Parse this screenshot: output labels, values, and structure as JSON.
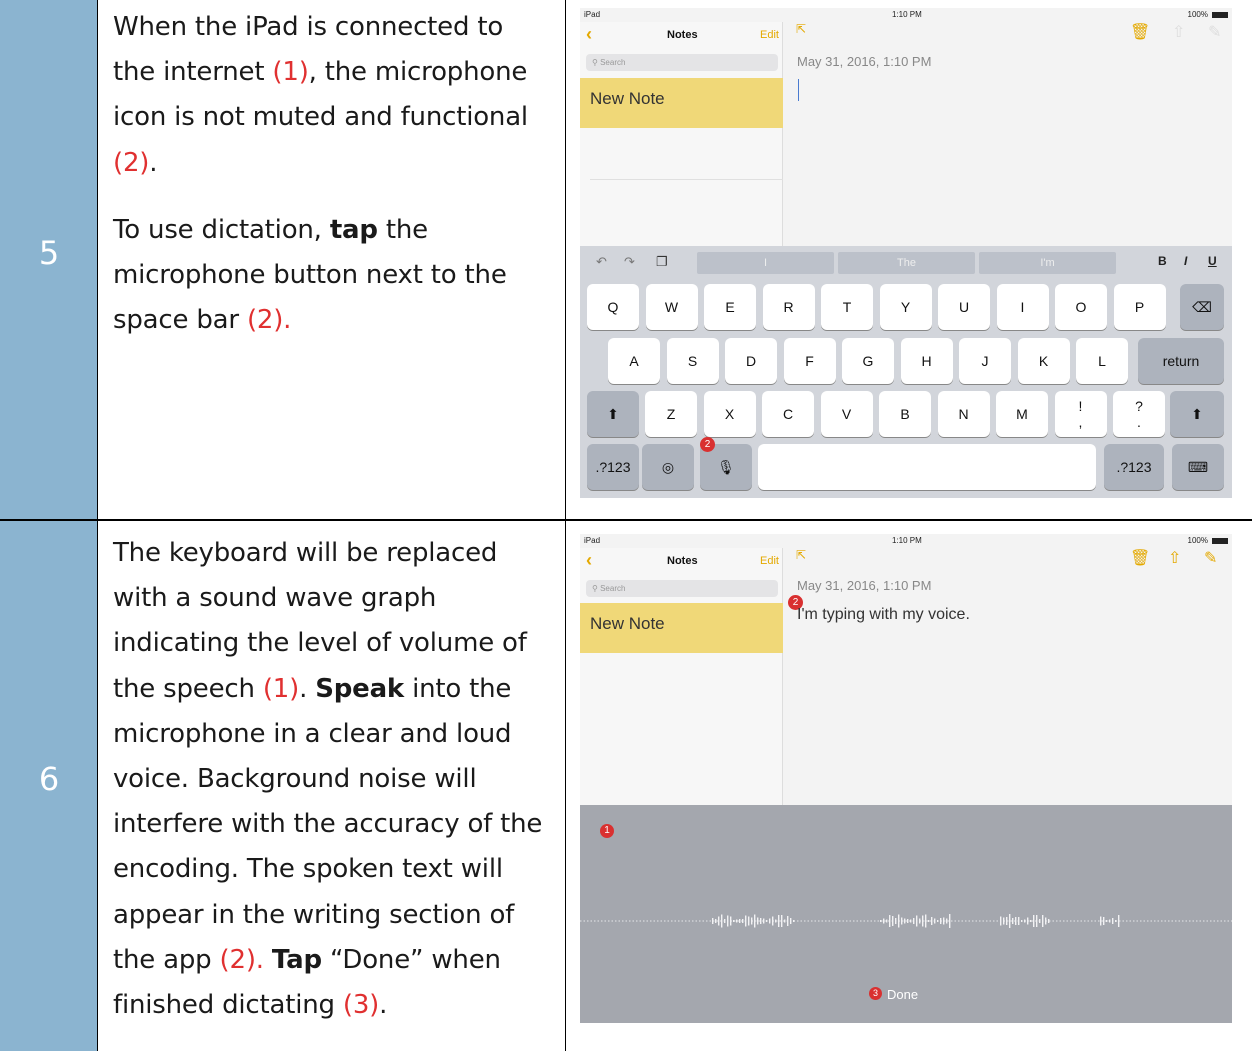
{
  "rows": [
    {
      "step": "5",
      "paragraphs": [
        [
          {
            "t": "When the iPad is connected to the internet ",
            "s": ""
          },
          {
            "t": "(1)",
            "s": "red"
          },
          {
            "t": ", the microphone icon is not muted and functional ",
            "s": ""
          },
          {
            "t": "(2)",
            "s": "red"
          },
          {
            "t": ".",
            "s": ""
          }
        ],
        [
          {
            "t": "To use dictation, ",
            "s": ""
          },
          {
            "t": "tap",
            "s": "bold"
          },
          {
            "t": " the microphone button next to the space bar ",
            "s": ""
          },
          {
            "t": "(2).",
            "s": "red"
          }
        ]
      ]
    },
    {
      "step": "6",
      "paragraphs": [
        [
          {
            "t": "The keyboard will be replaced with a sound wave graph indicating the level of volume of the speech ",
            "s": ""
          },
          {
            "t": "(1)",
            "s": "red"
          },
          {
            "t": ". ",
            "s": ""
          },
          {
            "t": "Speak",
            "s": "bold"
          },
          {
            "t": " into the microphone in a clear and loud voice.  Background noise will interfere with the accuracy of the encoding.   The spoken text will appear in the writing section of the app ",
            "s": ""
          },
          {
            "t": "(2).",
            "s": "red"
          },
          {
            "t": "  ",
            "s": ""
          },
          {
            "t": "Tap",
            "s": "bold"
          },
          {
            "t": " “Done” when finished dictating ",
            "s": ""
          },
          {
            "t": "(3)",
            "s": "red"
          },
          {
            "t": ".",
            "s": ""
          }
        ]
      ]
    }
  ],
  "screen1": {
    "status_left": "iPad",
    "status_time": "1:10 PM",
    "status_right": "100%",
    "nav_title": "Notes",
    "nav_edit": "Edit",
    "search_placeholder": "Search",
    "note_title": "New Note",
    "date": "May 31, 2016, 1:10 PM",
    "suggestions": [
      "I",
      "The",
      "I'm"
    ],
    "format_buttons": [
      "B",
      "I",
      "U"
    ],
    "key_rows": [
      [
        "Q",
        "W",
        "E",
        "R",
        "T",
        "Y",
        "U",
        "I",
        "O",
        "P"
      ],
      [
        "A",
        "S",
        "D",
        "F",
        "G",
        "H",
        "J",
        "K",
        "L"
      ],
      [
        "Z",
        "X",
        "C",
        "V",
        "B",
        "N",
        "M",
        "!\n,",
        "?\n."
      ]
    ],
    "return_label": "return",
    "numbers_label": ".?123",
    "badge_mic": "2"
  },
  "screen2": {
    "status_left": "iPad",
    "status_time": "1:10 PM",
    "status_right": "100%",
    "nav_title": "Notes",
    "nav_edit": "Edit",
    "search_placeholder": "Search",
    "note_title": "New Note",
    "date": "May 31, 2016, 1:10 PM",
    "typed_text": "I'm typing with my voice.",
    "done_label": "Done",
    "badge_wave": "1",
    "badge_text": "2",
    "badge_done": "3"
  },
  "colors": {
    "accent": "#e4a900",
    "note_highlight": "#f0d878",
    "step_column": "#8bb4d0",
    "callout": "#d93030"
  }
}
